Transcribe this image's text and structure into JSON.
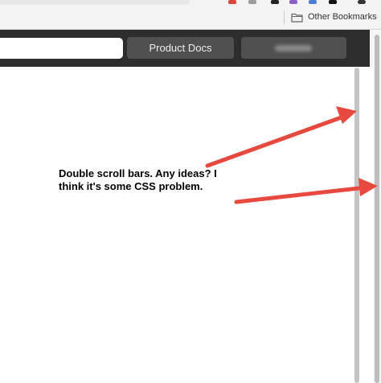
{
  "browser": {
    "bookmarks_bar": {
      "folder_label": "Other Bookmarks"
    }
  },
  "site_header": {
    "nav": [
      {
        "label": "Product Docs"
      },
      {
        "label": ""
      }
    ]
  },
  "annotation": {
    "text": "Double scroll bars. Any ideas? I think it's some CSS problem.",
    "arrow_color": "#e8493f"
  },
  "colors": {
    "header_bg": "#2d2d2d",
    "nav_button_bg": "#505050",
    "scrollbar_thumb": "#c4c4c4"
  }
}
